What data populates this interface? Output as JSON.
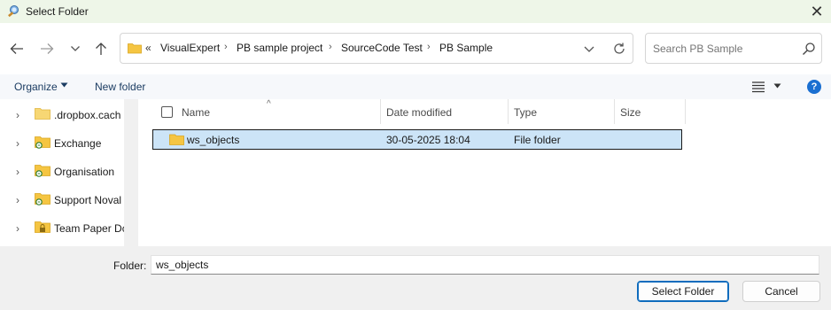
{
  "window": {
    "title": "Select Folder",
    "app_icon": "folder-picker-icon",
    "close_icon": "close-icon"
  },
  "nav": {
    "back_icon": "arrow-left-icon",
    "forward_icon": "arrow-right-icon",
    "recent_icon": "chevron-down-icon",
    "up_icon": "arrow-up-icon"
  },
  "address": {
    "overflow": "«",
    "crumbs": [
      "VisualExpert",
      "PB sample project",
      "SourceCode Test",
      "PB Sample"
    ],
    "separator": "›"
  },
  "search": {
    "placeholder": "Search PB Sample"
  },
  "toolbar": {
    "organize_label": "Organize",
    "new_folder_label": "New folder",
    "help_label": "?"
  },
  "sidebar": {
    "items": [
      {
        "label": ".dropbox.cach",
        "icon": "folder-icon"
      },
      {
        "label": "Exchange",
        "icon": "shared-folder-icon"
      },
      {
        "label": "Organisation",
        "icon": "shared-folder-icon"
      },
      {
        "label": "Support Noval",
        "icon": "shared-folder-icon"
      },
      {
        "label": "Team Paper Dc",
        "icon": "locked-folder-icon"
      }
    ]
  },
  "columns": {
    "name": "Name",
    "date_modified": "Date modified",
    "type": "Type",
    "size": "Size"
  },
  "files": [
    {
      "name": "ws_objects",
      "date_modified": "30-05-2025 18:04",
      "type": "File folder",
      "size": ""
    }
  ],
  "footer": {
    "folder_label": "Folder:",
    "folder_value": "ws_objects",
    "select_button": "Select Folder",
    "cancel_button": "Cancel"
  },
  "colors": {
    "accent": "#0f6cbd",
    "selection": "#cce4f7",
    "folder_yellow": "#f5c542",
    "title_bg": "#eef6e8"
  }
}
